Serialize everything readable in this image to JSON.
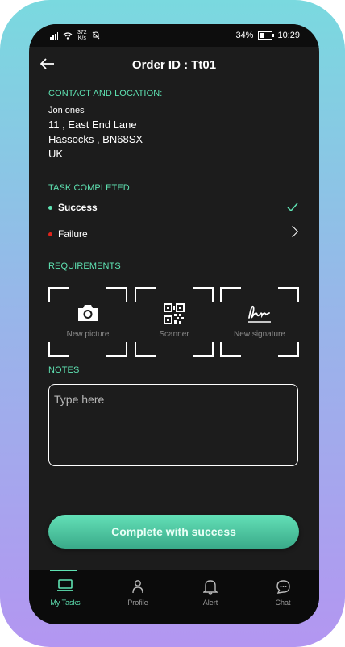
{
  "status_bar": {
    "speed_value": "372",
    "speed_unit": "K/s",
    "battery": "34%",
    "time": "10:29"
  },
  "header": {
    "title": "Order ID : Tt01"
  },
  "contact": {
    "label": "CONTACT AND LOCATION:",
    "name": "Jon ones",
    "line1": "11 , East End Lane",
    "line2": "Hassocks , BN68SX",
    "country": "UK"
  },
  "task": {
    "label": "TASK COMPLETED",
    "options": [
      {
        "label": "Success",
        "color": "#5fe3b3",
        "selected": true,
        "icon": "check-icon"
      },
      {
        "label": "Failure",
        "color": "#e0241b",
        "selected": false,
        "icon": "chevron-right-icon"
      }
    ]
  },
  "requirements": {
    "label": "REQUIREMENTS",
    "items": [
      {
        "label": "New picture",
        "icon": "camera-icon"
      },
      {
        "label": "Scanner",
        "icon": "qr-code-icon"
      },
      {
        "label": "New signature",
        "icon": "signature-icon"
      }
    ]
  },
  "notes": {
    "label": "NOTES",
    "placeholder": "Type here",
    "value": ""
  },
  "cta": {
    "label": "Complete with success"
  },
  "tabbar": {
    "tabs": [
      {
        "label": "My Tasks",
        "icon": "laptop-icon",
        "active": true
      },
      {
        "label": "Profile",
        "icon": "person-icon",
        "active": false
      },
      {
        "label": "Alert",
        "icon": "bell-icon",
        "active": false
      },
      {
        "label": "Chat",
        "icon": "chat-bubble-icon",
        "active": false
      }
    ]
  },
  "colors": {
    "accent": "#5fe3b3",
    "background": "#1c1c1c",
    "danger": "#e0241b"
  }
}
